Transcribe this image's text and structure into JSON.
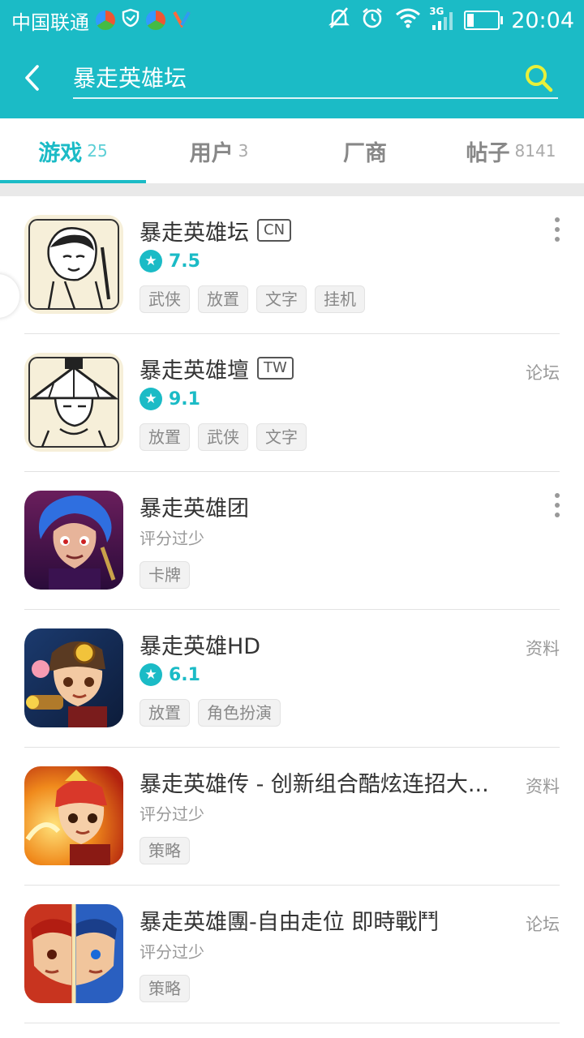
{
  "status_bar": {
    "carrier": "中国联通",
    "network": "3G",
    "time": "20:04"
  },
  "search": {
    "query": "暴走英雄坛",
    "placeholder": ""
  },
  "tabs": [
    {
      "label": "游戏",
      "count": "25",
      "active": true
    },
    {
      "label": "用户",
      "count": "3",
      "active": false
    },
    {
      "label": "厂商",
      "count": "",
      "active": false
    },
    {
      "label": "帖子",
      "count": "8141",
      "active": false
    }
  ],
  "results": [
    {
      "name": "暴走英雄坛",
      "region": "CN",
      "score": "7.5",
      "rating_note": "",
      "tags": [
        "武侠",
        "放置",
        "文字",
        "挂机"
      ],
      "side": "",
      "has_more": true,
      "icon": "sketch-swordsman-icon"
    },
    {
      "name": "暴走英雄壇",
      "region": "TW",
      "score": "9.1",
      "rating_note": "",
      "tags": [
        "放置",
        "武侠",
        "文字"
      ],
      "side": "论坛",
      "has_more": false,
      "icon": "sketch-straw-hat-icon"
    },
    {
      "name": "暴走英雄团",
      "region": "",
      "score": "",
      "rating_note": "评分过少",
      "tags": [
        "卡牌"
      ],
      "side": "",
      "has_more": true,
      "icon": "blue-hair-hero-icon"
    },
    {
      "name": "暴走英雄HD",
      "region": "",
      "score": "6.1",
      "rating_note": "",
      "tags": [
        "放置",
        "角色扮演"
      ],
      "side": "资料",
      "has_more": false,
      "icon": "gunner-hero-icon"
    },
    {
      "name": "暴走英雄传 - 创新组合酷炫连招大...",
      "region": "",
      "score": "",
      "rating_note": "评分过少",
      "tags": [
        "策略"
      ],
      "side": "资料",
      "has_more": false,
      "icon": "fire-warrior-icon"
    },
    {
      "name": "暴走英雄團-自由走位 即時戰鬥",
      "region": "",
      "score": "",
      "rating_note": "评分过少",
      "tags": [
        "策略"
      ],
      "side": "论坛",
      "has_more": false,
      "icon": "dual-face-hero-icon"
    }
  ],
  "colors": {
    "accent": "#1bbbc6",
    "search_icon": "#e8f03a"
  }
}
